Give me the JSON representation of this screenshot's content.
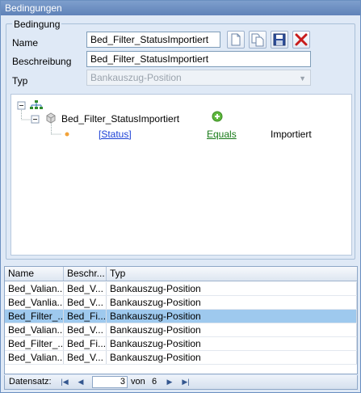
{
  "window": {
    "title": "Bedingungen"
  },
  "group": {
    "title": "Bedingung"
  },
  "form": {
    "name_label": "Name",
    "name_value": "Bed_Filter_StatusImportiert",
    "beschreibung_label": "Beschreibung",
    "beschreibung_value": "Bed_Filter_StatusImportiert",
    "typ_label": "Typ",
    "typ_value": "Bankauszug-Position"
  },
  "toolbar": {
    "new_icon": "new-document-icon",
    "copy_icon": "copy-icon",
    "save_icon": "save-icon",
    "delete_icon": "delete-icon"
  },
  "tree": {
    "node_label": "Bed_Filter_StatusImportiert",
    "field": "[Status]",
    "operator": "Equals",
    "value": "Importiert"
  },
  "grid": {
    "columns": [
      "Name",
      "Beschr...",
      "Typ"
    ],
    "rows": [
      [
        "Bed_Valian...",
        "Bed_V...",
        "Bankauszug-Position"
      ],
      [
        "Bed_Vanlia...",
        "Bed_V...",
        "Bankauszug-Position"
      ],
      [
        "Bed_Filter_...",
        "Bed_Fi...",
        "Bankauszug-Position"
      ],
      [
        "Bed_Valian...",
        "Bed_V...",
        "Bankauszug-Position"
      ],
      [
        "Bed_Filter_...",
        "Bed_Fi...",
        "Bankauszug-Position"
      ],
      [
        "Bed_Valian...",
        "Bed_V...",
        "Bankauszug-Position"
      ]
    ],
    "selected_row": 3
  },
  "navigator": {
    "label": "Datensatz:",
    "current": "3",
    "of_label": "von",
    "total": "6"
  },
  "colors": {
    "titlebar": "#6b8dc3",
    "background": "#dfe9f6",
    "selection": "#9ec9ee"
  }
}
